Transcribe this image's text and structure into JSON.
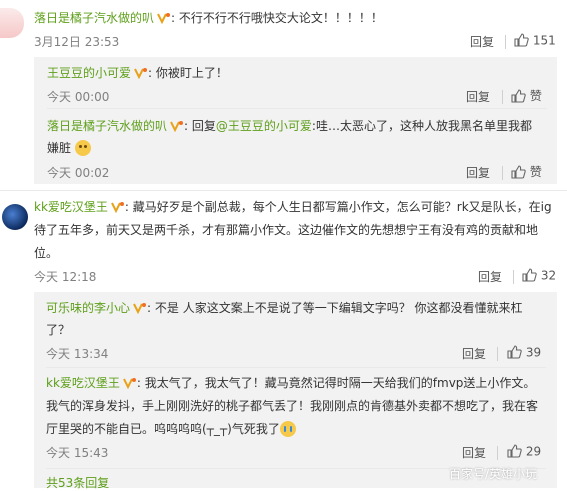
{
  "comments": [
    {
      "user": "落日是橘子汽水做的叭",
      "text": "不行不行不行哦快交大论文！！！！！",
      "time": "3月12日 23:53",
      "reply_label": "回复",
      "likes": "151"
    },
    {
      "user": "王豆豆的小可爱",
      "text": "你被盯上了！",
      "time": "今天 00:00",
      "reply_label": "回复",
      "likes": "赞"
    },
    {
      "user": "落日是橘子汽水做的叭",
      "prefix": "回复",
      "mention": "@王豆豆的小可爱",
      "text_line1": ":哇…太恶心了，这种人放我黑名单里我都",
      "text_line2": "嫌脏",
      "time": "今天 00:02",
      "reply_label": "回复",
      "likes": "赞"
    },
    {
      "user": "kk爱吃汉堡王",
      "text_line1": "藏马好歹是个副总裁，每个人生日都写篇小作文，怎么可能？rk又是队长，在ig",
      "text_line2": "待了五年多，前天又是两千杀，才有那篇小作文。这边催作文的先想想宁王有没有鸡的贡献和地",
      "text_line3": "位。",
      "time": "今天 12:18",
      "reply_label": "回复",
      "likes": "32"
    },
    {
      "user": "可乐味的李小心",
      "text_line1": "不是 人家这文案上不是说了等一下编辑文字吗？ 你这都没看懂就来杠",
      "text_line2": "了？",
      "time": "今天 13:34",
      "reply_label": "回复",
      "likes": "39"
    },
    {
      "user": "kk爱吃汉堡王",
      "text_line1": "我太气了，我太气了！藏马竟然记得时隔一天给我们的fmvp送上小作文。",
      "text_line2": "我气的浑身发抖，手上刚刚洗好的桃子都气丢了！我刚刚点的肯德基外卖都不想吃了，我在客",
      "text_line3": "厅里哭的不能自已。呜呜呜呜(┬_┬)气死我了",
      "time": "今天 15:43",
      "reply_label": "回复",
      "likes": "29"
    }
  ],
  "footer": {
    "total_replies": "共53条回复"
  },
  "watermark": "百家号/英雄小玩",
  "colors": {
    "username": "#5e9f1a",
    "reply_bg": "#f2f2f2",
    "meta": "#808080"
  }
}
